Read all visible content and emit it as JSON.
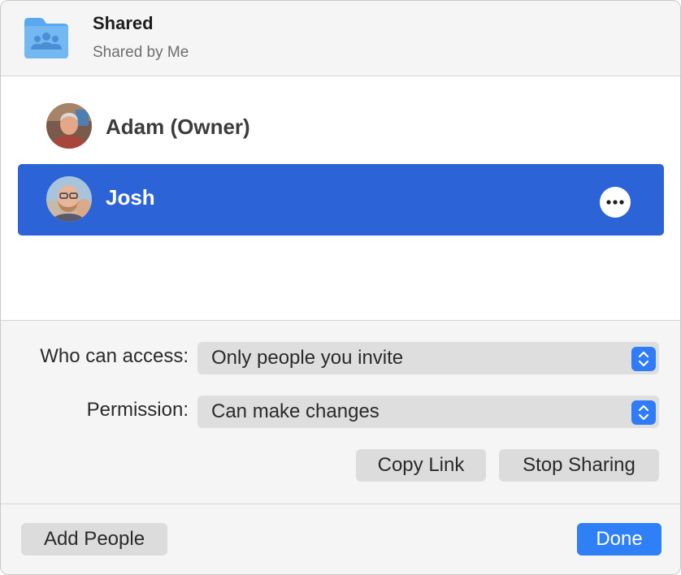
{
  "header": {
    "title": "Shared",
    "subtitle": "Shared by Me",
    "icon": "shared-folder-icon"
  },
  "people": [
    {
      "name": "Adam",
      "role": "(Owner)",
      "avatar": "avatar-adam",
      "selected": false
    },
    {
      "name": "Josh",
      "role": "",
      "avatar": "avatar-josh",
      "selected": true,
      "more_icon": "ellipsis-icon"
    }
  ],
  "access": {
    "label": "Who can access:",
    "value": "Only people you invite"
  },
  "permission": {
    "label": "Permission:",
    "value": "Can make changes"
  },
  "actions": {
    "copy_link": "Copy Link",
    "stop_sharing": "Stop Sharing"
  },
  "footer": {
    "add_people": "Add People",
    "done": "Done"
  },
  "colors": {
    "selection": "#2c64d8",
    "accent": "#2f80f6",
    "folder": "#5aa8ee"
  }
}
